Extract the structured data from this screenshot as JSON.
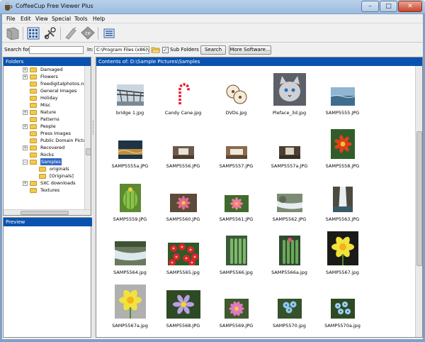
{
  "window": {
    "title": "CoffeeCup Free Viewer Plus",
    "minimize": "–",
    "maximize": "□",
    "close": "✕"
  },
  "menu": [
    "File",
    "Edit",
    "View",
    "Special",
    "Tools",
    "Help"
  ],
  "toolbar": {
    "buttons": [
      "back-icon",
      "thumbnails-icon",
      "crop-tool-icon",
      "plugin-icon",
      "zip-icon",
      "gallery-icon"
    ],
    "zip_label": "ZIP"
  },
  "search": {
    "label": "Search for:",
    "value": "",
    "in_label": "In:",
    "path": "C:\\Program Files (x86)\\Co",
    "subfolders_label": "Sub Folders",
    "subfolders_checked": true,
    "search_button": "Search",
    "more_button": "More Software..."
  },
  "folders": {
    "header": "Folders",
    "items": [
      {
        "label": "Damaged",
        "indent": 0,
        "expandable": true
      },
      {
        "label": "Flowers",
        "indent": 0,
        "expandable": true
      },
      {
        "label": "freedigitalphotos.net",
        "indent": 0,
        "expandable": false
      },
      {
        "label": "General Images",
        "indent": 0,
        "expandable": false
      },
      {
        "label": "Holiday",
        "indent": 0,
        "expandable": false
      },
      {
        "label": "Misc",
        "indent": 0,
        "expandable": false
      },
      {
        "label": "Nature",
        "indent": 0,
        "expandable": true
      },
      {
        "label": "Patterns",
        "indent": 0,
        "expandable": false
      },
      {
        "label": "People",
        "indent": 0,
        "expandable": true
      },
      {
        "label": "Press Images",
        "indent": 0,
        "expandable": false
      },
      {
        "label": "Public Domain Pictur",
        "indent": 0,
        "expandable": false
      },
      {
        "label": "Recovered",
        "indent": 0,
        "expandable": true
      },
      {
        "label": "Rocks",
        "indent": 0,
        "expandable": false
      },
      {
        "label": "Samples",
        "indent": 0,
        "expandable": true,
        "selected": true
      },
      {
        "label": "originals",
        "indent": 1,
        "expandable": false
      },
      {
        "label": "[Originals]",
        "indent": 1,
        "expandable": false
      },
      {
        "label": "SXC downloads",
        "indent": 0,
        "expandable": true
      },
      {
        "label": "Textures",
        "indent": 0,
        "expandable": false
      }
    ]
  },
  "preview": {
    "header": "Preview"
  },
  "contents": {
    "header": "Contents of: D:\\Sample Pictures\\Samples",
    "items": [
      {
        "name": "bridge 1.jpg",
        "kind": "bridge"
      },
      {
        "name": "Candy Cane.jpg",
        "kind": "cane"
      },
      {
        "name": "DVDs.jpg",
        "kind": "dvd"
      },
      {
        "name": "Pleface_3d.jpg",
        "kind": "cat"
      },
      {
        "name": "SAMP5555.JPG",
        "kind": "water"
      },
      {
        "name": "SAMP5555a.JPG",
        "kind": "water2"
      },
      {
        "name": "SAMP5556.JPG",
        "kind": "room"
      },
      {
        "name": "SAMP5557.JPG",
        "kind": "room2"
      },
      {
        "name": "SAMP5557a.JPG",
        "kind": "room3"
      },
      {
        "name": "SAMP5558.JPG",
        "kind": "redflower"
      },
      {
        "name": "SAMP5559.JPG",
        "kind": "cactus"
      },
      {
        "name": "SAMP5560.JPG",
        "kind": "pinkflower"
      },
      {
        "name": "SAMP5561.JPG",
        "kind": "pinkflower2"
      },
      {
        "name": "SAMP5562.JPG",
        "kind": "stream"
      },
      {
        "name": "SAMP5563.JPG",
        "kind": "waterfall"
      },
      {
        "name": "SAMP5564.jpg",
        "kind": "stream2"
      },
      {
        "name": "SAMP5565.jpg",
        "kind": "redflowers"
      },
      {
        "name": "SAMP5566.jpg",
        "kind": "cactus2"
      },
      {
        "name": "SAMP5566a.jpg",
        "kind": "cactus3"
      },
      {
        "name": "SAMP5567.jpg",
        "kind": "daffodil"
      },
      {
        "name": "SAMP5567a.jpg",
        "kind": "daffodil2"
      },
      {
        "name": "SAMP5568.JPG",
        "kind": "purpleflower"
      },
      {
        "name": "SAMP5569.JPG",
        "kind": "pinkflower3"
      },
      {
        "name": "SAMP5570.jpg",
        "kind": "blueflower"
      },
      {
        "name": "SAMP5570a.jpg",
        "kind": "blueflower2"
      }
    ]
  },
  "colors": {
    "accent": "#0a52b0",
    "selection": "#316ac5",
    "folder": "#f2c94c"
  }
}
